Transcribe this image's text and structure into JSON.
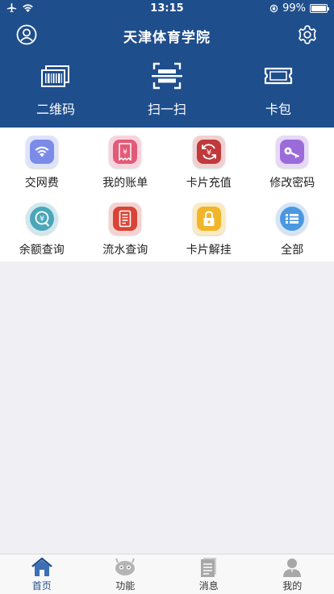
{
  "status": {
    "time": "13:15",
    "battery": "99%",
    "battery_level": 0.99
  },
  "header": {
    "title": "天津体育学院"
  },
  "quick_actions": [
    {
      "label": "二维码",
      "icon": "barcode-icon"
    },
    {
      "label": "扫一扫",
      "icon": "scan-icon"
    },
    {
      "label": "卡包",
      "icon": "card-wallet-icon"
    }
  ],
  "services": [
    {
      "label": "交网费",
      "icon": "wifi-icon",
      "color": "#7b8be8"
    },
    {
      "label": "我的账单",
      "icon": "bill-icon",
      "color": "#e35a77"
    },
    {
      "label": "卡片充值",
      "icon": "recharge-icon",
      "color": "#c0393b"
    },
    {
      "label": "修改密码",
      "icon": "key-icon",
      "color": "#9a6bd9"
    },
    {
      "label": "余额查询",
      "icon": "balance-icon",
      "color": "#4aa6b8"
    },
    {
      "label": "流水查询",
      "icon": "transactions-icon",
      "color": "#d94437"
    },
    {
      "label": "卡片解挂",
      "icon": "unlock-icon",
      "color": "#f1b52a"
    },
    {
      "label": "全部",
      "icon": "all-menu-icon",
      "color": "#4b98e0"
    }
  ],
  "tabbar": [
    {
      "label": "首页",
      "icon": "home-icon",
      "active": true
    },
    {
      "label": "功能",
      "icon": "functions-icon",
      "active": false
    },
    {
      "label": "消息",
      "icon": "messages-icon",
      "active": false
    },
    {
      "label": "我的",
      "icon": "profile-icon",
      "active": false
    }
  ],
  "colors": {
    "brand": "#1f4e8c",
    "background": "#efeff4",
    "active_tab": "#1f4e8c"
  }
}
